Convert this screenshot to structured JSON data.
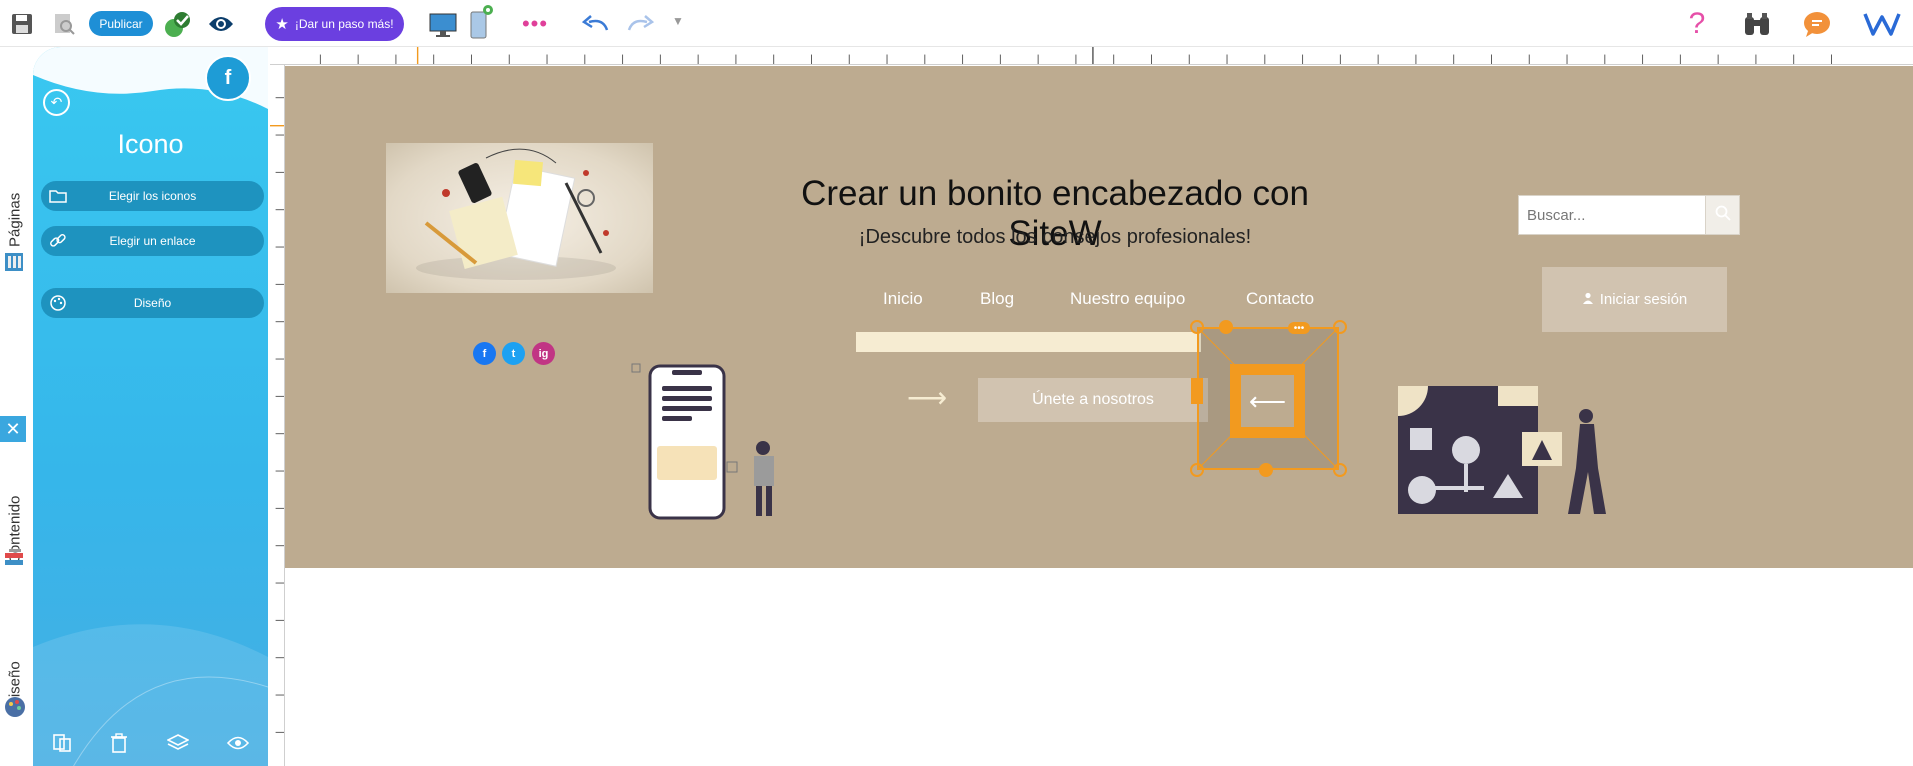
{
  "toolbar": {
    "publish_label": "Publicar",
    "upgrade_label": "¡Dar un paso más!",
    "icons": [
      "save-icon",
      "preview-search-icon",
      "check-icon",
      "eye-icon",
      "desktop-icon",
      "mobile-icon",
      "more-icon",
      "undo-icon",
      "redo-icon",
      "chevron-down-icon",
      "help-icon",
      "binoculars-icon",
      "chat-icon",
      "sitew-logo"
    ]
  },
  "sidetabs": {
    "pages": "Páginas",
    "content": "Contenido",
    "design": "Diseño",
    "close": "✕"
  },
  "panel": {
    "title": "Icono",
    "buttons": [
      {
        "label": "Elegir los iconos",
        "icon": "folder-icon"
      },
      {
        "label": "Elegir un enlace",
        "icon": "link-icon"
      },
      {
        "label": "Diseño",
        "icon": "palette-icon"
      }
    ],
    "avatar_letter": "f",
    "footer_icons": [
      "duplicate-icon",
      "trash-icon",
      "layers-icon",
      "eye-icon"
    ]
  },
  "canvas": {
    "title": "Crear un bonito encabezado con SiteW",
    "subtitle": "¡Descubre todos los consejos profesionales!",
    "nav": [
      "Inicio",
      "Blog",
      "Nuestro equipo",
      "Contacto"
    ],
    "search_placeholder": "Buscar...",
    "login_label": "Iniciar sesión",
    "join_label": "Únete a nosotros",
    "social": [
      {
        "label": "f",
        "color": "#1877f2"
      },
      {
        "label": "t",
        "color": "#1da1f2"
      },
      {
        "label": "ig",
        "color": "#c13584"
      }
    ]
  },
  "colors": {
    "accent": "#36b6ea",
    "banner": "#bdab90",
    "selection": "#f29a1f",
    "upgrade": "#6b3fe0",
    "publish": "#1e8fd6"
  }
}
